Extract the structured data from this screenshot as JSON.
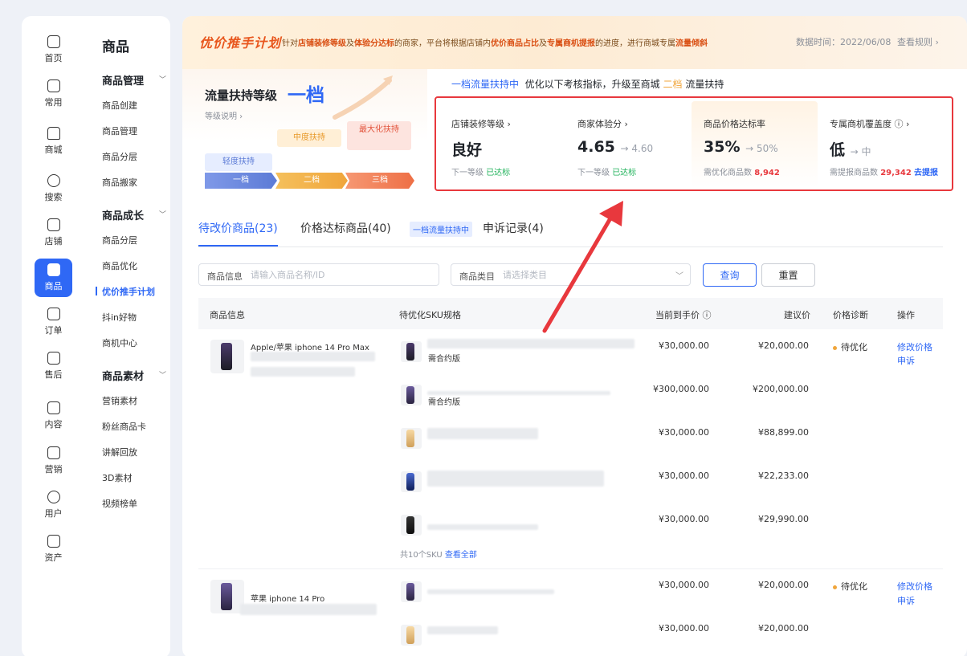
{
  "rail": [
    {
      "label": "首页",
      "icon": "home-icon"
    },
    {
      "label": "常用",
      "icon": "folder-icon"
    },
    {
      "label": "商城",
      "icon": "shop-icon"
    },
    {
      "label": "搜索",
      "icon": "search-icon"
    },
    {
      "label": "店铺",
      "icon": "store-icon"
    },
    {
      "label": "商品",
      "icon": "goods-icon",
      "active": true
    },
    {
      "label": "订单",
      "icon": "order-icon"
    },
    {
      "label": "售后",
      "icon": "aftersale-icon"
    },
    {
      "label": "内容",
      "icon": "tv-icon"
    },
    {
      "label": "营销",
      "icon": "megaphone-icon"
    },
    {
      "label": "用户",
      "icon": "user-icon"
    },
    {
      "label": "资产",
      "icon": "wallet-icon"
    }
  ],
  "menu": {
    "title": "商品",
    "groups": [
      {
        "label": "商品管理",
        "items": [
          "商品创建",
          "商品管理",
          "商品分层",
          "商品搬家"
        ]
      },
      {
        "label": "商品成长",
        "items": [
          "商品分层",
          "商品优化",
          "优价推手计划",
          "抖in好物",
          "商机中心"
        ]
      },
      {
        "label": "商品素材",
        "items": [
          "营销素材",
          "粉丝商品卡",
          "讲解回放",
          "3D素材",
          "视频榜单"
        ]
      }
    ]
  },
  "banner": {
    "logo": "优价推手计划",
    "t1": "针对",
    "b1": "店铺装修等级",
    "t2": "及",
    "b2": "体验分达标",
    "t3": "的商家，平台将根据店铺内",
    "b3": "优价商品占比",
    "t4": "及",
    "b4": "专属商机提报",
    "t5": "的进度，进行商城专属",
    "b5": "流量倾斜",
    "date": "数据时间：2022/06/08",
    "rule": "查看规则 ›"
  },
  "tier": {
    "title": "流量扶持等级",
    "level": "一档",
    "desc": "等级说明 ›",
    "tag1": "轻度扶持",
    "tag2": "中度扶持",
    "tag3": "最大化扶持",
    "step1": "一档",
    "step2": "二档",
    "step3": "三档"
  },
  "support": {
    "current": "一档流量扶持中",
    "text1": "优化以下考核指标，升级至商城",
    "target": "二档",
    "text2": "流量扶持"
  },
  "metrics": [
    {
      "label": "店铺装修等级 ›",
      "value": "良好",
      "next": "",
      "sub1": "下一等级",
      "sub2": "已达标",
      "sub_type": "ok"
    },
    {
      "label": "商家体验分 ›",
      "value": "4.65",
      "next": "→ 4.60",
      "sub1": "下一等级",
      "sub2": "已达标",
      "sub_type": "ok"
    },
    {
      "label": "商品价格达标率",
      "value": "35%",
      "next": "→ 50%",
      "sub1": "需优化商品数",
      "sub2": "8,942",
      "sub_type": "red"
    },
    {
      "label": "专属商机覆盖度 ⓘ ›",
      "value": "低",
      "next": "→ 中",
      "sub1": "需提报商品数",
      "sub2": "29,342",
      "sub_type": "red",
      "link": "去提报"
    }
  ],
  "tabs": {
    "t1": "待改价商品(23)",
    "t2": "价格达标商品(40)",
    "badge": "一档流量扶持中",
    "t3": "申诉记录(4)"
  },
  "filters": {
    "info_label": "商品信息",
    "info_placeholder": "请输入商品名称/ID",
    "cat_label": "商品类目",
    "cat_placeholder": "请选择类目",
    "query": "查询",
    "reset": "重置"
  },
  "table": {
    "headers": [
      "商品信息",
      "待优化SKU规格",
      "当前到手价 ⓘ",
      "建议价",
      "价格诊断",
      "操作"
    ],
    "products": [
      {
        "name": "Apple/苹果 iphone 14 Pro Max",
        "status": "待优化",
        "op1": "修改价格",
        "op2": "申诉",
        "skus": [
          {
            "text": "需合约版",
            "current": "¥30,000.00",
            "suggest": "¥20,000.00",
            "color": "dark"
          },
          {
            "text": "需合约版",
            "current": "¥300,000.00",
            "suggest": "¥200,000.00",
            "color": "purple"
          },
          {
            "text": "",
            "current": "¥30,000.00",
            "suggest": "¥88,899.00",
            "color": "gold"
          },
          {
            "text": "",
            "current": "¥30,000.00",
            "suggest": "¥22,233.00",
            "color": "blue"
          },
          {
            "text": "",
            "current": "¥30,000.00",
            "suggest": "¥29,990.00",
            "color": "black"
          }
        ],
        "sku_count": "共10个SKU",
        "sku_link": "查看全部"
      },
      {
        "name": "苹果 iphone 14 Pro",
        "status": "待优化",
        "op1": "修改价格",
        "op2": "申诉",
        "skus": [
          {
            "text": "",
            "current": "¥30,000.00",
            "suggest": "¥20,000.00",
            "color": "purple"
          },
          {
            "text": "",
            "current": "¥30,000.00",
            "suggest": "¥20,000.00",
            "color": "gold"
          }
        ]
      }
    ]
  },
  "colors": {
    "accent": "#2f68f5",
    "highlight_border": "#e8383d",
    "arrow": "#e8383d",
    "ok": "#1fb25a",
    "warn": "#f0a53b"
  }
}
